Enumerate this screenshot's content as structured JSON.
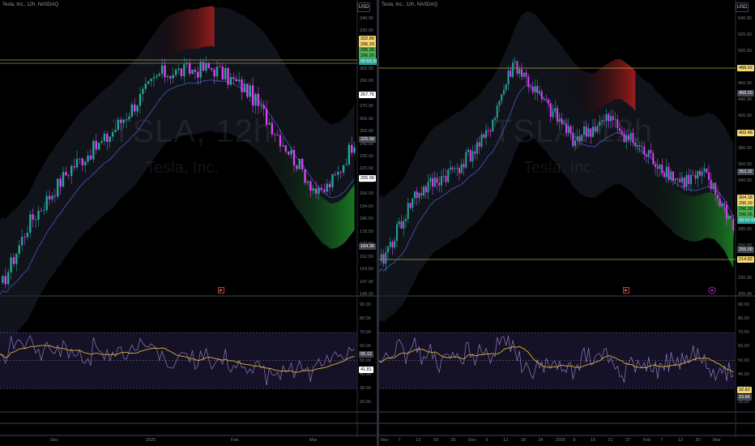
{
  "colors": {
    "bg": "#000000",
    "candle_up": "#26a69a",
    "candle_down": "#e040fb",
    "red_band": "#8b1a1a",
    "green_band": "#1b5e20",
    "ma_line": "#3f51b5",
    "rsi_line": "#8e7cc3",
    "rsi_ma": "#d4b43c",
    "tag_green": "#4caf50",
    "tag_yellow": "#f5d76e",
    "tag_teal": "#26a69a",
    "tag_dark": "#434651"
  },
  "left": {
    "symbol_line": "Tesla, Inc., 12h, NASDAQ",
    "currency": "USD",
    "watermark_symbol": "TSLA, 12h",
    "watermark_name": "Tesla, Inc.",
    "price_ticks": [
      "340.00",
      "330.00",
      "320.00",
      "310.00",
      "300.00",
      "290.00",
      "280.00",
      "270.00",
      "260.00",
      "250.00",
      "240.00",
      "230.00",
      "220.00",
      "210.00",
      "200.00",
      "194.50",
      "186.50",
      "178.50",
      "170.50",
      "162.50",
      "154.50",
      "147.00",
      "140.00"
    ],
    "price_tags": [
      {
        "text": "332.89",
        "kind": "yellow"
      },
      {
        "text": "296.29",
        "kind": "yellow"
      },
      {
        "text": "296.30",
        "kind": "green"
      },
      {
        "text": "296.26",
        "kind": "green"
      },
      {
        "text": "00:55:38",
        "kind": "teal"
      },
      {
        "text": "267.75",
        "kind": "white"
      },
      {
        "text": "225.09",
        "kind": "dark"
      },
      {
        "text": "205.09",
        "kind": "white"
      },
      {
        "text": "164.36",
        "kind": "dark"
      }
    ],
    "rsi_ticks": [
      "90.00",
      "80.00",
      "70.00",
      "60.00",
      "50.00",
      "40.00",
      "30.00",
      "20.00"
    ],
    "rsi_tags": [
      {
        "text": "55.12",
        "kind": "dark"
      },
      {
        "text": "41.81",
        "kind": "white"
      }
    ],
    "time_labels": [
      "Dec",
      "2025",
      "Feb",
      "Mar"
    ]
  },
  "right": {
    "symbol_line": "Tesla, Inc., 12h, NASDAQ",
    "currency": "USD",
    "watermark_symbol": "TSLA, 12h",
    "watermark_name": "Tesla, Inc.",
    "price_ticks": [
      "540.00",
      "520.00",
      "500.00",
      "480.00",
      "460.00",
      "440.00",
      "420.00",
      "400.00",
      "380.00",
      "360.00",
      "340.00",
      "320.00",
      "300.00",
      "280.00",
      "260.00",
      "240.00",
      "220.00",
      "200.00"
    ],
    "price_tags": [
      {
        "text": "488.52",
        "kind": "yellow"
      },
      {
        "text": "450.20",
        "kind": "dark"
      },
      {
        "text": "402.46",
        "kind": "yellow"
      },
      {
        "text": "353.32",
        "kind": "dark"
      },
      {
        "text": "304.18",
        "kind": "yellow"
      },
      {
        "text": "296.29",
        "kind": "yellow"
      },
      {
        "text": "296.30",
        "kind": "green"
      },
      {
        "text": "296.26",
        "kind": "green"
      },
      {
        "text": "00:01:08",
        "kind": "teal"
      },
      {
        "text": "255.00",
        "kind": "dark"
      },
      {
        "text": "214.82",
        "kind": "yellow"
      }
    ],
    "rsi_ticks": [
      "90.00",
      "80.00",
      "70.00",
      "60.00",
      "50.00",
      "40.00",
      "30.00",
      "20.00"
    ],
    "rsi_tags": [
      {
        "text": "32.82",
        "kind": "yellow"
      },
      {
        "text": "23.86",
        "kind": "dark"
      }
    ],
    "time_labels": [
      "Nov",
      "7",
      "13",
      "19",
      "25",
      "Dec",
      "6",
      "12",
      "18",
      "24",
      "2025",
      "9",
      "15",
      "21",
      "27",
      "Feb",
      "7",
      "13",
      "20",
      "Mar"
    ]
  }
}
